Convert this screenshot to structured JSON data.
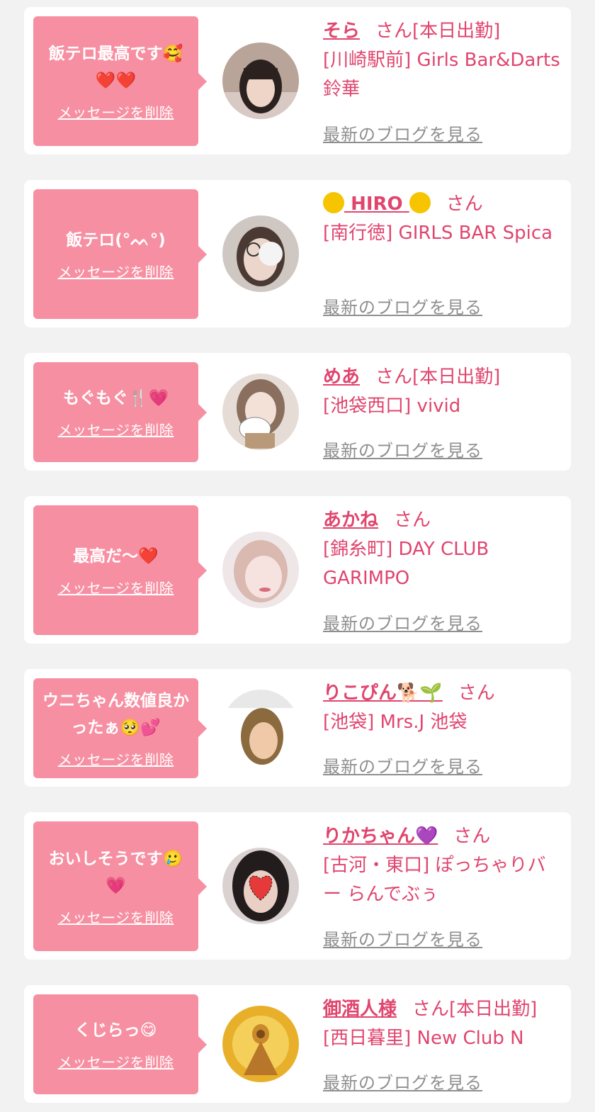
{
  "common": {
    "delete_label": "メッセージを削除",
    "blog_label": "最新のブログを見る",
    "san_suffix": "さん"
  },
  "items": [
    {
      "message": "飯テロ最高です🥰❤️❤️",
      "name": "そら",
      "status": "[本日出勤]",
      "shop": "[川崎駅前] Girls Bar&Darts 鈴華"
    },
    {
      "message": "飯テロ(°ᨓ°)",
      "name": "HIRO",
      "status": "",
      "shop": "[南行徳] GIRLS BAR Spica"
    },
    {
      "message": "もぐもぐ🍴💗",
      "name": "めあ",
      "status": "[本日出勤]",
      "shop": "[池袋西口] vivid"
    },
    {
      "message": "最高だ〜❤️",
      "name": "あかね",
      "status": "",
      "shop": "[錦糸町] DAY CLUB GARIMPO"
    },
    {
      "message": "ウニちゃん数値良かったぁ🥺💕",
      "name": "りこぴん🐕🌱",
      "status": "",
      "shop": "[池袋] Mrs.J 池袋"
    },
    {
      "message": "おいしそうです🥲💗",
      "name": "りかちゃん💜",
      "status": "",
      "shop": "[古河・東口] ぽっちゃりバー らんでぶぅ"
    },
    {
      "message": "くじらっ😋",
      "name": "御酒人様",
      "status": "[本日出勤]",
      "shop": "[西日暮里] New Club N"
    }
  ]
}
